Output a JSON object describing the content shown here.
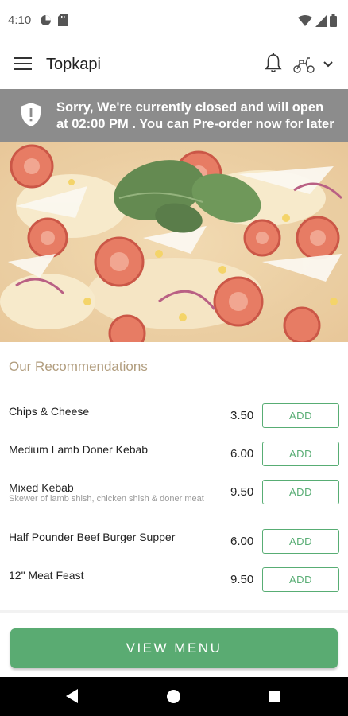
{
  "status_bar": {
    "time": "4:10"
  },
  "app_bar": {
    "title": "Topkapi"
  },
  "banner": {
    "message": "Sorry, We're currently closed and will open at 02:00 PM . You can Pre-order now for later"
  },
  "recommendations": {
    "title": "Our Recommendations",
    "items": [
      {
        "name": "Chips & Cheese",
        "description": "",
        "price": "3.50",
        "button": "ADD"
      },
      {
        "name": "Medium Lamb Doner Kebab",
        "description": "",
        "price": "6.00",
        "button": "ADD"
      },
      {
        "name": "Mixed Kebab",
        "description": "Skewer of lamb shish, chicken shish & doner meat",
        "price": "9.50",
        "button": "ADD"
      },
      {
        "name": "Half Pounder Beef Burger Supper",
        "description": "",
        "price": "6.00",
        "button": "ADD"
      },
      {
        "name": "12\" Meat Feast",
        "description": "",
        "price": "9.50",
        "button": "ADD"
      }
    ]
  },
  "view_menu_label": "VIEW MENU",
  "colors": {
    "accent": "#5aab72",
    "banner": "#8c8c8c",
    "section_title": "#b19d7e"
  }
}
